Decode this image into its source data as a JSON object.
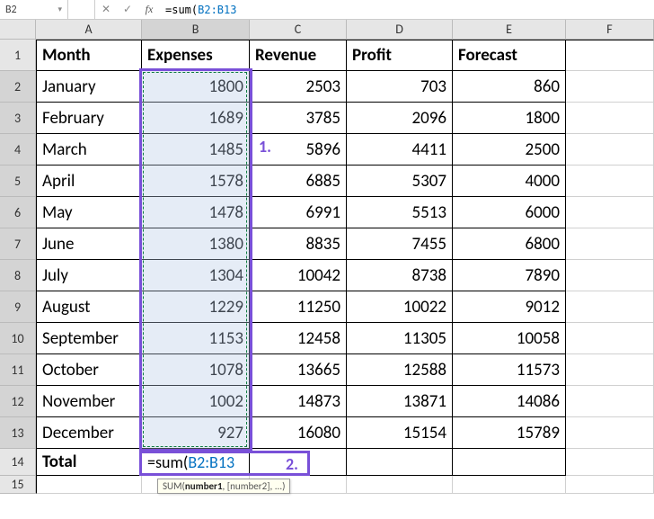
{
  "name_box": "B2",
  "formula_bar": {
    "prefix": "=sum(",
    "ref": "B2:B13"
  },
  "columns": [
    "A",
    "B",
    "C",
    "D",
    "E",
    "F"
  ],
  "row_numbers": [
    1,
    2,
    3,
    4,
    5,
    6,
    7,
    8,
    9,
    10,
    11,
    12,
    13,
    14,
    15
  ],
  "headers": {
    "A": "Month",
    "B": "Expenses",
    "C": "Revenue",
    "D": "Profit",
    "E": "Forecast"
  },
  "data": [
    {
      "A": "January",
      "B": 1800,
      "C": 2503,
      "D": 703,
      "E": 860
    },
    {
      "A": "February",
      "B": 1689,
      "C": 3785,
      "D": 2096,
      "E": 1800
    },
    {
      "A": "March",
      "B": 1485,
      "C": 5896,
      "D": 4411,
      "E": 2500
    },
    {
      "A": "April",
      "B": 1578,
      "C": 6885,
      "D": 5307,
      "E": 4000
    },
    {
      "A": "May",
      "B": 1478,
      "C": 6991,
      "D": 5513,
      "E": 6000
    },
    {
      "A": "June",
      "B": 1380,
      "C": 8835,
      "D": 7455,
      "E": 6800
    },
    {
      "A": "July",
      "B": 1304,
      "C": 10042,
      "D": 8738,
      "E": 7890
    },
    {
      "A": "August",
      "B": 1229,
      "C": 11250,
      "D": 10022,
      "E": 9012
    },
    {
      "A": "September",
      "B": 1153,
      "C": 12458,
      "D": 11305,
      "E": 10058
    },
    {
      "A": "October",
      "B": 1078,
      "C": 13665,
      "D": 12588,
      "E": 11573
    },
    {
      "A": "November",
      "B": 1002,
      "C": 14873,
      "D": 13871,
      "E": 14086
    },
    {
      "A": "December",
      "B": 927,
      "C": 16080,
      "D": 15154,
      "E": 15789
    }
  ],
  "total_label": "Total",
  "b14_formula": {
    "prefix": "=sum(",
    "ref": "B2:B13"
  },
  "tooltip": {
    "fn": "SUM(",
    "arg_bold": "number1",
    "rest": ", [number2], ...)"
  },
  "annotations": {
    "label1": "1.",
    "label2": "2."
  },
  "icons": {
    "cancel": "✕",
    "accept": "✓",
    "fx": "fx"
  }
}
